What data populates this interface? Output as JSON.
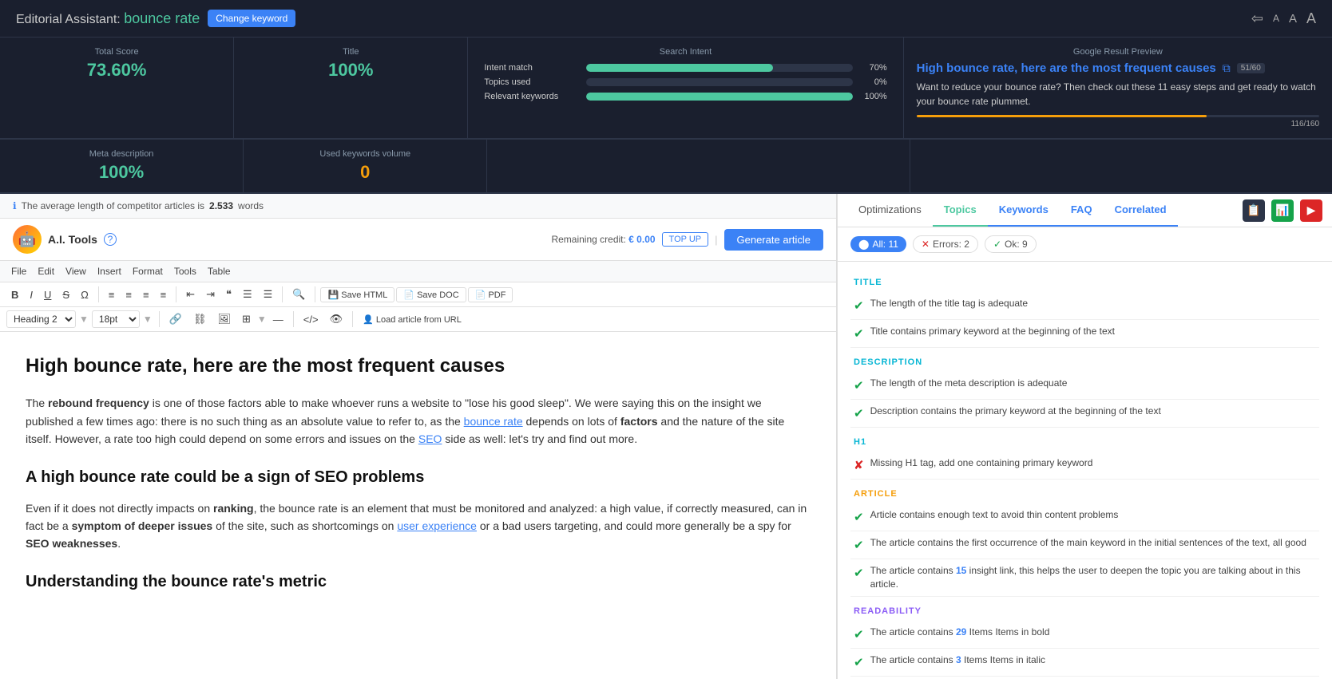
{
  "header": {
    "app_name": "Editorial Assistant:",
    "keyword": "bounce rate",
    "change_keyword_label": "Change keyword",
    "font_sizes": [
      "A",
      "A",
      "A"
    ]
  },
  "metrics": {
    "total_score": {
      "label": "Total Score",
      "value": "73.60%",
      "color": "green"
    },
    "title": {
      "label": "Title",
      "value": "100%",
      "color": "green"
    },
    "meta_description": {
      "label": "Meta description",
      "value": "100%",
      "color": "green"
    },
    "used_keywords_volume": {
      "label": "Used keywords volume",
      "value": "0",
      "color": "orange"
    }
  },
  "search_intent": {
    "title": "Search Intent",
    "rows": [
      {
        "label": "Intent match",
        "pct": 70,
        "pct_label": "70%"
      },
      {
        "label": "Topics used",
        "pct": 0,
        "pct_label": "0%"
      },
      {
        "label": "Relevant keywords",
        "pct": 100,
        "pct_label": "100%"
      }
    ]
  },
  "google_preview": {
    "title": "Google Result Preview",
    "link_text": "High bounce rate, here are the most frequent causes",
    "title_chars": "51/60",
    "description": "Want to reduce your bounce rate? Then check out these 11 easy steps and get ready to watch your bounce rate plummet.",
    "desc_chars": "116/160",
    "desc_bar_pct": 72
  },
  "info_bar": {
    "text": "The average length of competitor articles is",
    "words": "2.533",
    "suffix": "words"
  },
  "ai_tools": {
    "label": "A.I. Tools",
    "credit_label": "Remaining credit:",
    "credit_amount": "€ 0.00",
    "topup_label": "TOP UP",
    "generate_label": "Generate article"
  },
  "editor_toolbar": {
    "menu_items": [
      "File",
      "Edit",
      "View",
      "Insert",
      "Format",
      "Tools",
      "Table"
    ]
  },
  "format_bar": {
    "heading_value": "Heading 2",
    "size_value": "18pt",
    "save_html": "Save HTML",
    "save_doc": "Save DOC",
    "pdf": "PDF",
    "load_url": "Load article from URL"
  },
  "editor_content": {
    "h1": "High bounce rate, here are the most frequent causes",
    "p1_pre": "The ",
    "p1_bold": "rebound frequency",
    "p1_mid": " is one of those factors able to make whoever runs a website to \"lose his good sleep\". We were saying this on the insight we published a few times ago: there is no such thing as an absolute value to refer to, as the ",
    "p1_link": "bounce rate",
    "p1_post_pre": " depends on lots of ",
    "p1_bold2": "factors",
    "p1_post": " and the nature of the site itself. However, a rate too high could depend on some errors and issues on the ",
    "p1_link2": "SEO",
    "p1_end": " side as well: let's try and find out more.",
    "h2": "A high bounce rate could be a sign of SEO problems",
    "p2_pre": "Even if it does not directly impacts on ",
    "p2_bold": "ranking",
    "p2_mid": ", the bounce rate is an element that must be monitored and analyzed: a high value, if correctly measured, can in fact be a ",
    "p2_bold2": "symptom of deeper issues",
    "p2_post": " of the site, such as shortcomings on ",
    "p2_link": "user experience",
    "p2_end": " or a bad users targeting, and could more generally be a spy for ",
    "p2_bold3": "SEO weaknesses",
    "p2_final": ".",
    "h3": "Understanding the bounce rate's metric"
  },
  "right_panel": {
    "tabs": [
      {
        "label": "Optimizations",
        "active": false
      },
      {
        "label": "Topics",
        "active": false
      },
      {
        "label": "Keywords",
        "active": false
      },
      {
        "label": "FAQ",
        "active": false
      },
      {
        "label": "Correlated",
        "active": true
      }
    ],
    "tab_icons": [
      {
        "label": "📄",
        "name": "document-icon"
      },
      {
        "label": "📊",
        "name": "chart-icon"
      },
      {
        "label": "▶",
        "name": "video-icon",
        "color": "red"
      }
    ],
    "filters": {
      "all": {
        "label": "All: 11"
      },
      "errors": {
        "label": "Errors: 2"
      },
      "ok": {
        "label": "Ok: 9"
      }
    },
    "sections": [
      {
        "title": "TITLE",
        "color": "cyan",
        "items": [
          {
            "ok": true,
            "text": "The length of the title tag is adequate"
          },
          {
            "ok": true,
            "text": "Title contains primary keyword at the beginning of the text"
          }
        ]
      },
      {
        "title": "DESCRIPTION",
        "color": "cyan",
        "items": [
          {
            "ok": true,
            "text": "The length of the meta description is adequate"
          },
          {
            "ok": true,
            "text": "Description contains the primary keyword at the beginning of the text"
          }
        ]
      },
      {
        "title": "H1",
        "color": "cyan",
        "items": [
          {
            "ok": false,
            "text": "Missing H1 tag, add one containing primary keyword"
          }
        ]
      },
      {
        "title": "ARTICLE",
        "color": "orange",
        "items": [
          {
            "ok": true,
            "text": "Article contains enough text to avoid thin content problems"
          },
          {
            "ok": true,
            "text": "The article contains the first occurrence of the main keyword in the initial sentences of the text, all good"
          },
          {
            "ok": true,
            "text": "The article contains {15} insight link, this helps the user to deepen the topic you are talking about in this article.",
            "num": "15",
            "num_pos": "after_contains"
          }
        ]
      },
      {
        "title": "READABILITY",
        "color": "purple",
        "items": [
          {
            "ok": true,
            "text": "The article contains {29} Items Items in bold",
            "num": "29"
          },
          {
            "ok": true,
            "text": "The article contains {3} Items Items in italic",
            "num": "3"
          }
        ]
      }
    ]
  }
}
